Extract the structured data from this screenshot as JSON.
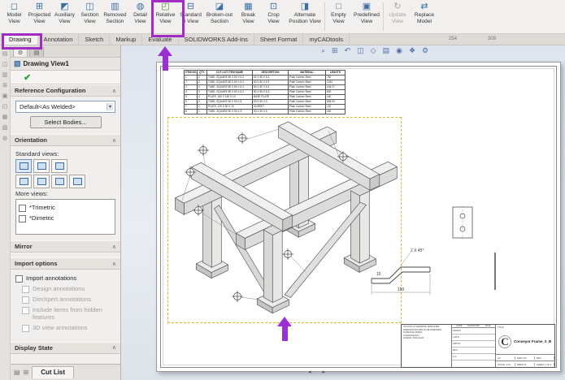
{
  "toolbar": {
    "buttons": [
      {
        "label": "Model\nView",
        "glyph": "◻"
      },
      {
        "label": "Projected\nView",
        "glyph": "⊞"
      },
      {
        "label": "Auxiliary\nView",
        "glyph": "◩"
      },
      {
        "label": "Section\nView",
        "glyph": "◫"
      },
      {
        "label": "Removed\nSection",
        "glyph": "▥"
      },
      {
        "label": "Detail\nView",
        "glyph": "◍"
      },
      {
        "label": "Relative\nView",
        "glyph": "◰"
      },
      {
        "label": "Standard\n3 View",
        "glyph": "⊟"
      },
      {
        "label": "Broken-out\nSection",
        "glyph": "◪"
      },
      {
        "label": "Break\nView",
        "glyph": "▦"
      },
      {
        "label": "Crop\nView",
        "glyph": "⊡"
      },
      {
        "label": "Alternate\nPosition View",
        "glyph": "◨"
      },
      {
        "label": "Empty\nView",
        "glyph": "□"
      },
      {
        "label": "Predefined\nView",
        "glyph": "▣"
      },
      {
        "label": "Update\nView",
        "glyph": "↻"
      },
      {
        "label": "Replace\nModel",
        "glyph": "⇄"
      }
    ]
  },
  "ribbon_tabs": [
    {
      "label": "Drawing"
    },
    {
      "label": "Annotation"
    },
    {
      "label": "Sketch"
    },
    {
      "label": "Markup"
    },
    {
      "label": "Evaluate"
    },
    {
      "label": "SOLIDWORKS Add-Ins"
    },
    {
      "label": "Sheet Format"
    },
    {
      "label": "myCADtools"
    }
  ],
  "ruler_marks": [
    "254",
    "309"
  ],
  "side_strip_icons": [
    "▤",
    "◫",
    "▥",
    "⊞",
    "▣",
    "◰",
    "▦",
    "▧",
    "◍"
  ],
  "hud_icons": [
    {
      "glyph": "⌕"
    },
    {
      "glyph": "⊞"
    },
    {
      "glyph": "↶"
    },
    {
      "glyph": "◫"
    },
    {
      "glyph": "◇"
    },
    {
      "glyph": "▤"
    },
    {
      "glyph": "◉"
    },
    {
      "glyph": "❖"
    },
    {
      "glyph": "⚙"
    }
  ],
  "property_panel": {
    "tab_glyphs": [
      "⚙",
      "▤"
    ],
    "title_glyph": "▧",
    "title": "Drawing View1",
    "check_glyph": "✔",
    "sections": [
      "Reference Configuration",
      "Orientation",
      "Mirror",
      "Import options",
      "Display State"
    ],
    "chevron": "∧",
    "reference_configuration": {
      "dropdown_value": "Default<As Welded>",
      "dropdown_arrow": "▾",
      "select_bodies_button": "Select Bodies..."
    },
    "orientation": {
      "standard_views_label": "Standard views:",
      "more_views_label": "More views:",
      "more_views": [
        "*Trimetric",
        "*Dimetric"
      ]
    },
    "import_options": [
      {
        "label": "Import annotations"
      },
      {
        "label": "Design annotations"
      },
      {
        "label": "DimXpert annotations"
      },
      {
        "label": "Include items from hidden features"
      },
      {
        "label": "3D view annotations"
      }
    ],
    "bottom_tab": "Cut List",
    "bottom_tab_icons": [
      "▤",
      "⊞"
    ]
  },
  "graphics": {
    "sheet_scroll_glyphs": "◂ ▸",
    "bom_table": {
      "headers": [
        "ITEM NO.",
        "QTY.",
        "CUT LIST ITEM NAME",
        "DESCRIPTION",
        "MATERIAL",
        "LENGTH"
      ],
      "rows": [
        [
          "1",
          "2",
          "TUBE, SQUARE 80 X 80 X 6.3",
          "80 X 80 X 6.3",
          "Plain Carbon Steel",
          "760"
        ],
        [
          "2",
          "2",
          "TUBE, SQUARE 80 X 80 X 6.3",
          "80 X 80 X 6.3",
          "Plain Carbon Steel",
          "1240"
        ],
        [
          "3",
          "4",
          "TUBE, SQUARE 80 X 80 X 6.3",
          "80 X 80 X 6.3",
          "Plain Carbon Steel",
          "106.27"
        ],
        [
          "4",
          "4",
          "TUBE, SQUARE 80 X 80 X 6.3",
          "80 X 80 X 6.3",
          "Plain Carbon Steel",
          "600"
        ],
        [
          "5",
          "4",
          "PLATE, 160 X 160 X 10",
          "BASE PLATE",
          "Plain Carbon Steel",
          "160"
        ],
        [
          "6",
          "2",
          "TUBE, SQUARE 50 X 50 X 5",
          "50 X 50 X 5",
          "Plain Carbon Steel",
          "848.53"
        ],
        [
          "7",
          "2",
          "PLATE, 120 X 80 X 10",
          "GUSSET",
          "Plain Carbon Steel",
          "120"
        ],
        [
          "8",
          "1",
          "TUBE, SQUARE 50 X 50 X 5",
          "50 X 50 X 5",
          "Plain Carbon Steel",
          "400"
        ]
      ]
    },
    "dimensions": {
      "d1": "150",
      "d2": "15",
      "d3": "2 X 45°"
    },
    "title_block": {
      "notes": [
        "UNLESS OTHERWISE SPECIFIED:",
        "DIMENSIONS ARE IN MILLIMETERS",
        "SURFACE FINISH:",
        "TOLERANCES:",
        "LINEAR:   ANGULAR:"
      ],
      "sign_cols": [
        "NAME",
        "SIGNATURE",
        "DATE"
      ],
      "sign_rows": [
        "DRAWN",
        "CHK'D",
        "APPV'D",
        "MFG",
        "Q.A"
      ],
      "title_label": "TITLE:",
      "logo": "C",
      "title": "Conveyor Frame_0_B",
      "size": "A2",
      "dwg_label": "DWG NO.",
      "rev_label": "REV",
      "scale": "SCALE: 1:10",
      "weight": "WEIGHT:",
      "sheet": "SHEET 1 OF 1"
    }
  }
}
